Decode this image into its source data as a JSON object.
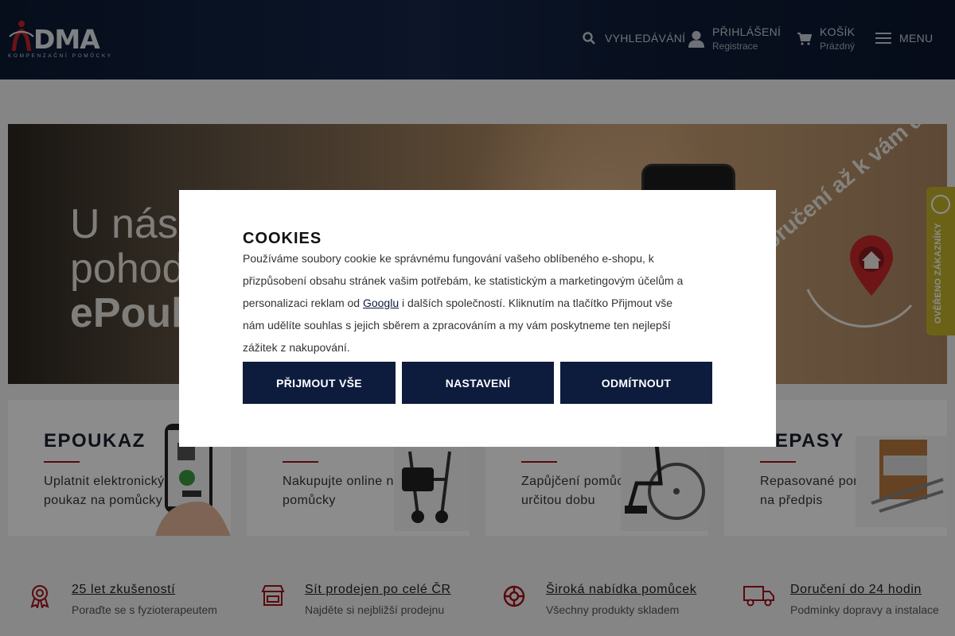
{
  "header": {
    "logo": {
      "word": "DMA",
      "tagline": "KOMPENZAČNÍ POMŮCKY"
    },
    "search": {
      "label": "VYHLEDÁVÁNÍ",
      "icon": "search-icon"
    },
    "login": {
      "label": "PŘIHLÁŠENÍ",
      "sub": "Registrace",
      "icon": "user-icon"
    },
    "cart": {
      "label": "KOŠÍK",
      "sub": "Prázdný",
      "icon": "cart-icon"
    },
    "menu": {
      "label": "MENU",
      "icon": "hamburger-icon"
    }
  },
  "hero": {
    "line1": "U nás",
    "line2": "pohod",
    "line3": "ePouk",
    "delivery_text": "Doručení až k vám domů",
    "icon": "location-pin-home-icon"
  },
  "verified_badge": {
    "label": "OVĚŘENO ZÁKAZNÍKY",
    "icon": "heureka-icon"
  },
  "cards": [
    {
      "title": "EPOUKAZ",
      "desc": "Uplatnit elektronický poukaz na pomůcky"
    },
    {
      "title": "",
      "desc": "Nakupujte online nové pomůcky"
    },
    {
      "title": "",
      "desc": "Zapůjčení pomůcek po určitou dobu"
    },
    {
      "title": "REPASY",
      "desc": "Repasované pomůcky na předpis"
    }
  ],
  "features": [
    {
      "title": "25 let zkušeností",
      "sub": "Poraďte se s fyzioterapeutem",
      "icon": "award-icon"
    },
    {
      "title": "Sít prodejen po celé ČR",
      "sub": "Najděte si nejbližší prodejnu",
      "icon": "store-icon"
    },
    {
      "title": "Široká nabídka pomůcek",
      "sub": "Všechny produkty skladem",
      "icon": "lifebuoy-icon"
    },
    {
      "title": "Doručení do 24 hodin",
      "sub": "Podmínky dopravy a instalace",
      "icon": "truck-icon"
    }
  ],
  "cookies": {
    "title": "COOKIES",
    "text_before": "Používáme soubory cookie ke správnému fungování vašeho oblíbeného e-shopu, k přizpůsobení obsahu stránek vašim potřebám, ke statistickým a marketingovým účelům a personalizaci reklam od ",
    "link": "Googlu",
    "text_after": " i dalších společností. Kliknutím na tlačítko Přijmout vše nám udělíte souhlas s jejich sběrem a zpracováním a my vám poskytneme ten nejlepší zážitek z nakupování.",
    "buttons": {
      "accept": "PŘIJMOUT VŠE",
      "settings": "NASTAVENÍ",
      "reject": "ODMÍTNOUT"
    }
  },
  "colors": {
    "navy": "#0d1c3d",
    "accent_red": "#a3121b",
    "badge_yellow": "#c3b22b"
  }
}
